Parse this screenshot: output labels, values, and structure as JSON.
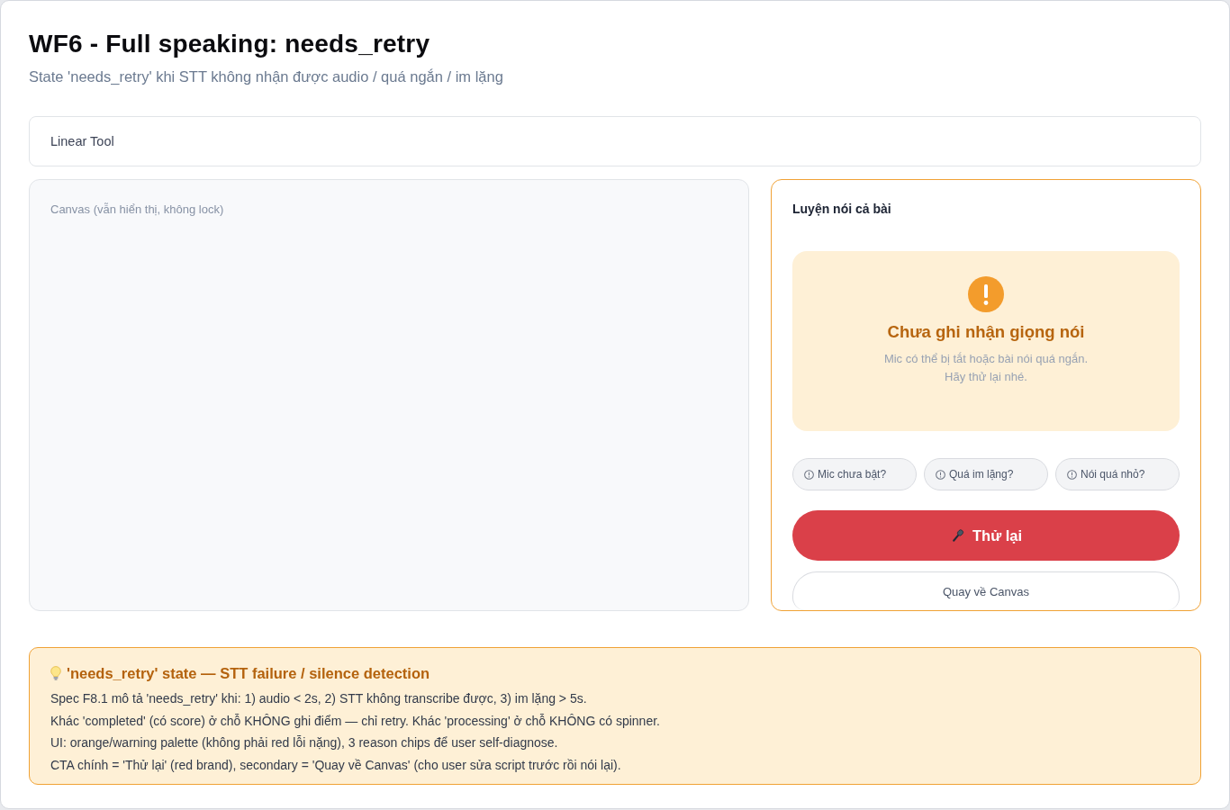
{
  "header": {
    "title": "WF6 - Full speaking: needs_retry",
    "subtitle": "State 'needs_retry' khi STT không nhận được audio / quá ngắn / im lặng"
  },
  "toolbar": {
    "label": "Linear Tool"
  },
  "canvas": {
    "label": "Canvas (vẫn hiển thị, không lock)"
  },
  "speaking_panel": {
    "title": "Luyện nói cả bài",
    "status": {
      "kind": "warning",
      "heading": "Chưa ghi nhận giọng nói",
      "message_lines": [
        "Mic có thể bị tắt hoặc bài nói quá ngắn.",
        "Hãy thử lại nhé."
      ]
    },
    "reason_chips": [
      "Mic chưa bật?",
      "Quá im lặng?",
      "Nói quá nhỏ?"
    ],
    "primary_button": "Thử lại",
    "secondary_button": "Quay về Canvas"
  },
  "note": {
    "title": "'needs_retry' state — STT failure / silence detection",
    "lines": [
      "Spec F8.1 mô tả 'needs_retry' khi: 1) audio < 2s, 2) STT không transcribe được, 3) im lặng > 5s.",
      "Khác 'completed' (có score) ở chỗ KHÔNG ghi điểm — chỉ retry. Khác 'processing' ở chỗ KHÔNG có spinner.",
      "UI: orange/warning palette (không phải red lỗi nặng), 3 reason chips để user self-diagnose.",
      "CTA chính = 'Thử lại' (red brand), secondary = 'Quay về Canvas' (cho user sửa script trước rồi nói lại)."
    ]
  }
}
